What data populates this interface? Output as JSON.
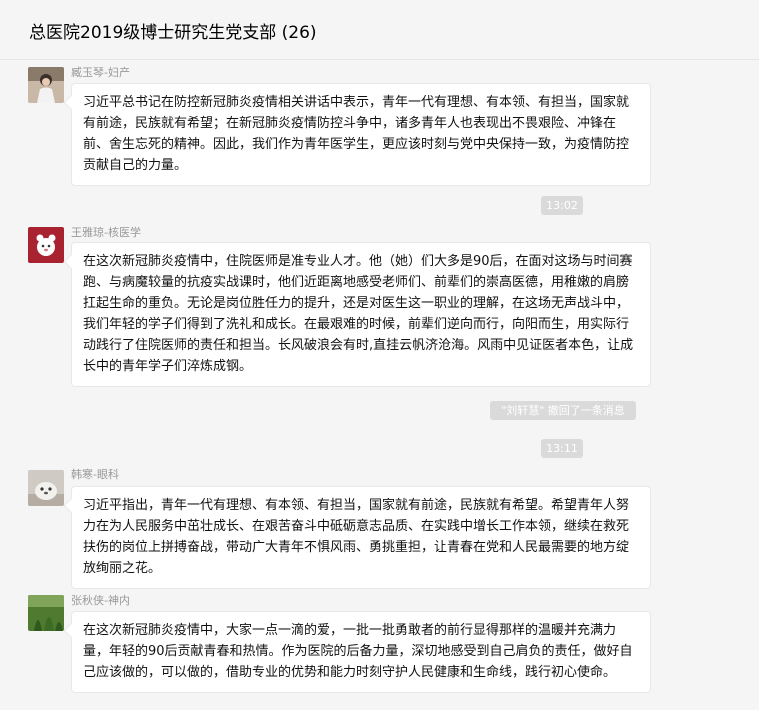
{
  "chat": {
    "title": "总医院2019级博士研究生党支部 (26)"
  },
  "messages": [
    {
      "sender": "臧玉琴-妇产",
      "avatar": "person-photo-avatar",
      "text": "习近平总书记在防控新冠肺炎疫情相关讲话中表示，青年一代有理想、有本领、有担当，国家就有前途，民族就有希望；在新冠肺炎疫情防控斗争中，诸多青年人也表现出不畏艰险、冲锋在前、舍生忘死的精神。因此，我们作为青年医学生，更应该时刻与党中央保持一致，为疫情防控贡献自己的力量。"
    },
    {
      "sender": "王雅琼-核医学",
      "avatar": "cartoon-avatar",
      "text": "在这次新冠肺炎疫情中，住院医师是准专业人才。他（她）们大多是90后，在面对这场与时间赛跑、与病魔较量的抗疫实战课时，他们近距离地感受老师们、前辈们的崇高医德，用稚嫩的肩膀扛起生命的重负。无论是岗位胜任力的提升，还是对医生这一职业的理解，在这场无声战斗中，我们年轻的学子们得到了洗礼和成长。在最艰难的时候，前辈们逆向而行，向阳而生，用实际行动践行了住院医师的责任和担当。长风破浪会有时,直挂云帆济沧海。风雨中见证医者本色，让成长中的青年学子们淬炼成钢。"
    },
    {
      "sender": "韩寒-眼科",
      "avatar": "animal-photo-avatar",
      "text": "习近平指出，青年一代有理想、有本领、有担当，国家就有前途，民族就有希望。希望青年人努力在为人民服务中茁壮成长、在艰苦奋斗中砥砺意志品质、在实践中增长工作本领，继续在救死扶伤的岗位上拼搏奋战，带动广大青年不惧风雨、勇挑重担，让青春在党和人民最需要的地方绽放绚丽之花。"
    },
    {
      "sender": "张秋侠-神内",
      "avatar": "nature-photo-avatar",
      "text": "在这次新冠肺炎疫情中，大家一点一滴的爱，一批一批勇敢者的前行显得那样的温暖并充满力量，年轻的90后贡献青春和热情。作为医院的后备力量，深切地感受到自己肩负的责任，做好自己应该做的，可以做的，借助专业的优势和能力时刻守护人民健康和生命线，践行初心使命。"
    }
  ],
  "system": {
    "time_1": "13:02",
    "recall_notice": "\"刘轩慧\" 撤回了一条消息",
    "time_2": "13:11"
  },
  "colors": {
    "background": "#f5f5f5",
    "bubble": "#ffffff",
    "pill": "#dadada",
    "sender": "#999999"
  }
}
